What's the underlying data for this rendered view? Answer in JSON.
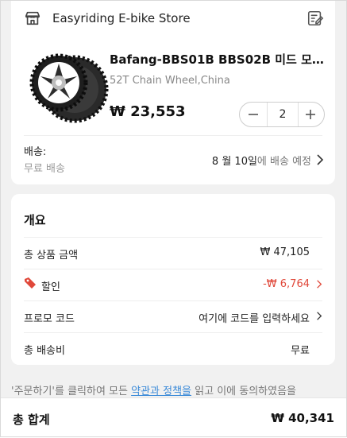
{
  "store": {
    "name": "Easyriding E-bike Store",
    "store_icon": "store-icon",
    "note_icon": "note-edit-icon"
  },
  "product": {
    "title": "Bafang-BBS01B BBS02B 미드 모터 ...",
    "variant": "52T Chain Wheel,China",
    "price": "₩ 23,553",
    "quantity": "2"
  },
  "shipping": {
    "label": "배송:",
    "sub": "무료 배송",
    "date": "8 월 10일",
    "date_suffix": "에 배송 예정"
  },
  "summary": {
    "title": "개요",
    "subtotal_label": "총 상품 금액",
    "subtotal_value": "₩ 47,105",
    "discount_label": "할인",
    "discount_value": "-₩ 6,764",
    "promo_label": "프로모 코드",
    "promo_value": "여기에 코드를 입력하세요",
    "shipping_label": "총 배송비",
    "shipping_value": "무료"
  },
  "footer": {
    "note_before": "'주문하기'를 클릭하여 모든 ",
    "note_link": "약관과 정책을",
    "note_after": " 읽고 이에 동의하였음을"
  },
  "total": {
    "label": "총 합계",
    "value": "₩ 40,341"
  },
  "colors": {
    "discount": "#e0483a",
    "link": "#3b8ad8"
  }
}
